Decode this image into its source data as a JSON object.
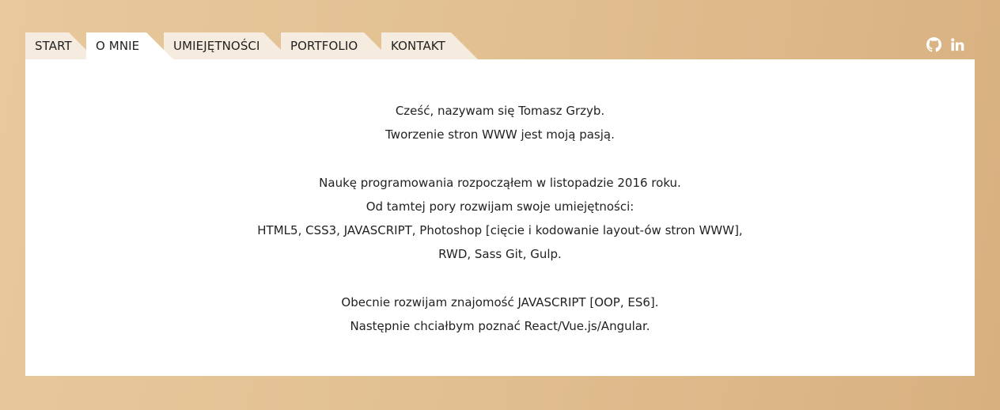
{
  "nav": {
    "tabs": [
      {
        "label": "START"
      },
      {
        "label": "O MNIE"
      },
      {
        "label": "UMIEJĘTNOŚCI"
      },
      {
        "label": "PORTFOLIO"
      },
      {
        "label": "KONTAKT"
      }
    ],
    "active": "O MNIE"
  },
  "social": {
    "icons": [
      "github-icon",
      "linkedin-icon"
    ]
  },
  "about": {
    "paragraphs": [
      {
        "lines": [
          "Cześć, nazywam się Tomasz Grzyb.",
          "Tworzenie stron WWW jest moją pasją."
        ]
      },
      {
        "lines": [
          "Naukę programowania rozpocząłem w listopadzie 2016 roku.",
          "Od tamtej pory rozwijam swoje umiejętności:",
          "HTML5, CSS3, JAVASCRIPT, Photoshop [cięcie i kodowanie layout-ów stron WWW],",
          "RWD, Sass Git, Gulp."
        ]
      },
      {
        "lines": [
          "Obecnie rozwijam znajomość JAVASCRIPT [OOP, ES6].",
          "Następnie chciałbym poznać React/Vue.js/Angular."
        ]
      }
    ]
  },
  "colors": {
    "background": "#e2c092",
    "tab": "#f5ebde",
    "active_tab": "#ffffff",
    "text": "#222222"
  }
}
